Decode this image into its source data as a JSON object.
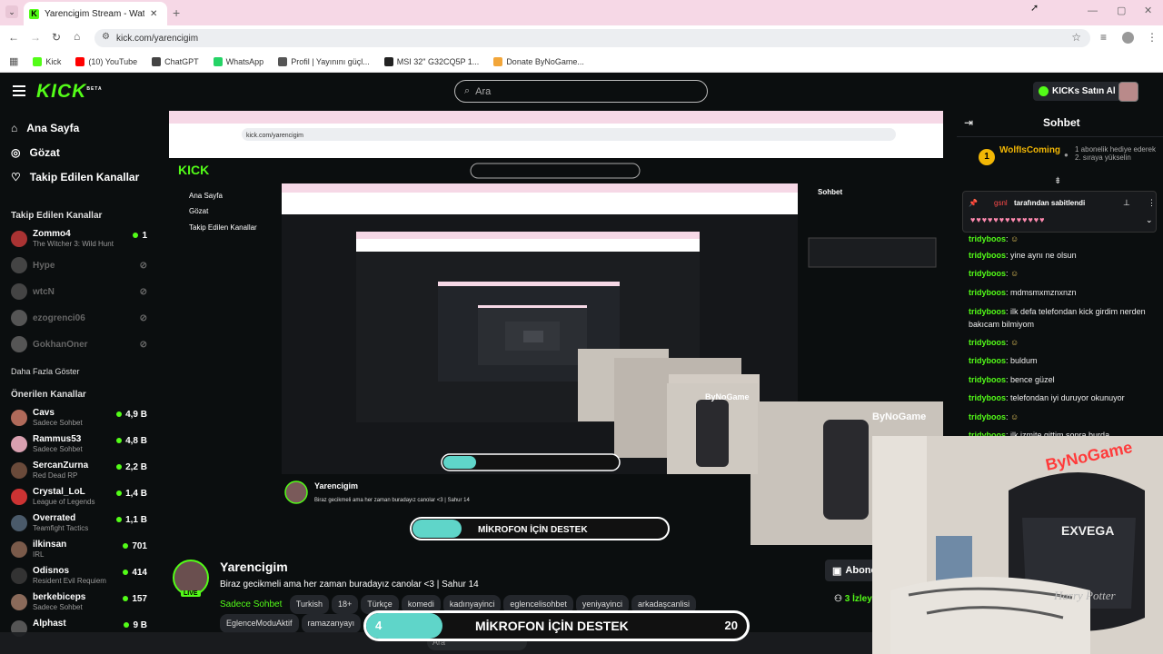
{
  "browser": {
    "tab_title": "Yarencigim Stream - Watch Live",
    "url": "kick.com/yarencigim",
    "bookmarks": [
      {
        "label": "Kick",
        "color": "#53fc18"
      },
      {
        "label": "(10) YouTube",
        "color": "#ff0000"
      },
      {
        "label": "ChatGPT",
        "color": "#444444"
      },
      {
        "label": "WhatsApp",
        "color": "#25d366"
      },
      {
        "label": "Profil | Yayınını güçl...",
        "color": "#555555"
      },
      {
        "label": "MSI 32\" G32CQ5P 1...",
        "color": "#222222"
      },
      {
        "label": "Donate ByNoGame...",
        "color": "#f2a63a"
      }
    ]
  },
  "header": {
    "logo": "KICK",
    "logo_beta": "BETA",
    "search_placeholder": "Ara",
    "buy_kicks": "KICKs Satın Al"
  },
  "sidebar": {
    "nav": [
      {
        "label": "Ana Sayfa",
        "icon": "home-icon"
      },
      {
        "label": "Gözat",
        "icon": "compass-icon"
      },
      {
        "label": "Takip Edilen Kanallar",
        "icon": "heart-icon"
      }
    ],
    "followed_heading": "Takip Edilen Kanallar",
    "followed": [
      {
        "name": "Zommo4",
        "sub": "The Witcher 3: Wild Hunt",
        "count": "1",
        "live": true,
        "color": "#a33"
      },
      {
        "name": "Hype",
        "sub": "",
        "count": "",
        "live": false,
        "color": "#444"
      },
      {
        "name": "wtcN",
        "sub": "",
        "count": "",
        "live": false,
        "color": "#444"
      },
      {
        "name": "ezogrenci06",
        "sub": "",
        "count": "",
        "live": false,
        "color": "#555"
      },
      {
        "name": "GokhanOner",
        "sub": "",
        "count": "",
        "live": false,
        "color": "#555"
      }
    ],
    "show_more": "Daha Fazla Göster",
    "recommended_heading": "Önerilen Kanallar",
    "recommended": [
      {
        "name": "Cavs",
        "sub": "Sadece Sohbet",
        "count": "4,9 B",
        "color": "#b06a5a"
      },
      {
        "name": "Rammus53",
        "sub": "Sadece Sohbet",
        "count": "4,8 B",
        "color": "#d9a0b0"
      },
      {
        "name": "SercanZurna",
        "sub": "Red Dead RP",
        "count": "2,2 B",
        "color": "#6a4a3a"
      },
      {
        "name": "Crystal_LoL",
        "sub": "League of Legends",
        "count": "1,4 B",
        "color": "#c33"
      },
      {
        "name": "Overrated",
        "sub": "Teamfight Tactics",
        "count": "1,1 B",
        "color": "#4a5a6a"
      },
      {
        "name": "ilkinsan",
        "sub": "IRL",
        "count": "701",
        "color": "#7a5a4a"
      },
      {
        "name": "Odisnos",
        "sub": "Resident Evil Requiem",
        "count": "414",
        "color": "#333"
      },
      {
        "name": "berkebiceps",
        "sub": "Sadece Sohbet",
        "count": "157",
        "color": "#8a6a5a"
      },
      {
        "name": "Alphast",
        "sub": "",
        "count": "9 B",
        "color": "#555"
      }
    ]
  },
  "chat": {
    "title": "Sohbet",
    "gifter": "WolfIsComing",
    "gifter_rank": "1",
    "gift_note": "1 abonelik hediye ederek 2. sıraya yükselin",
    "pinned_by": "tarafından sabitlendi",
    "pinned_user": "gsnl",
    "messages": [
      {
        "user": "tridyboos",
        "text": ""
      },
      {
        "user": "tridyboos",
        "text": "yine aynı ne olsun"
      },
      {
        "user": "tridyboos",
        "text": ""
      },
      {
        "user": "tridyboos",
        "text": "mdmsmxmznxnzn"
      },
      {
        "user": "tridyboos",
        "text": "ilk defa telefondan kick girdim nerden bakıcam bilmiyom"
      },
      {
        "user": "tridyboos",
        "text": ""
      },
      {
        "user": "tridyboos",
        "text": "buldum"
      },
      {
        "user": "tridyboos",
        "text": "bence güzel"
      },
      {
        "user": "tridyboos",
        "text": "telefondan iyi duruyor okunuyor"
      },
      {
        "user": "tridyboos",
        "text": ""
      },
      {
        "user": "tridyboos",
        "text": "ilk izmite gittim sonra burda"
      }
    ]
  },
  "stream_info": {
    "channel": "Yarencigim",
    "live_badge": "LIVE",
    "title": "Biraz gecikmeli ama her zaman buradayız canolar <3 | Sahur 14",
    "category": "Sadece Sohbet",
    "tags": [
      "Turkish",
      "18+",
      "Türkçe",
      "komedi",
      "kadınyayinci",
      "eglencelisohbet",
      "yeniyayinci",
      "arkadaşcanlisi",
      "EglenceModuAktif",
      "ramazanyayı"
    ],
    "subscribe": "Abone",
    "viewers": "3 İzley"
  },
  "overlay": {
    "mikrofon_label": "MİKROFON İÇİN DESTEK",
    "mikrofon_left": "4",
    "mikrofon_right": "20",
    "mikrofon_progress": 0.2,
    "cam_brand": "ByNoGame",
    "chair_text": "EXVEGA",
    "chair_text2": "Harry Potter"
  },
  "taskbar": {
    "search": "Ara"
  }
}
